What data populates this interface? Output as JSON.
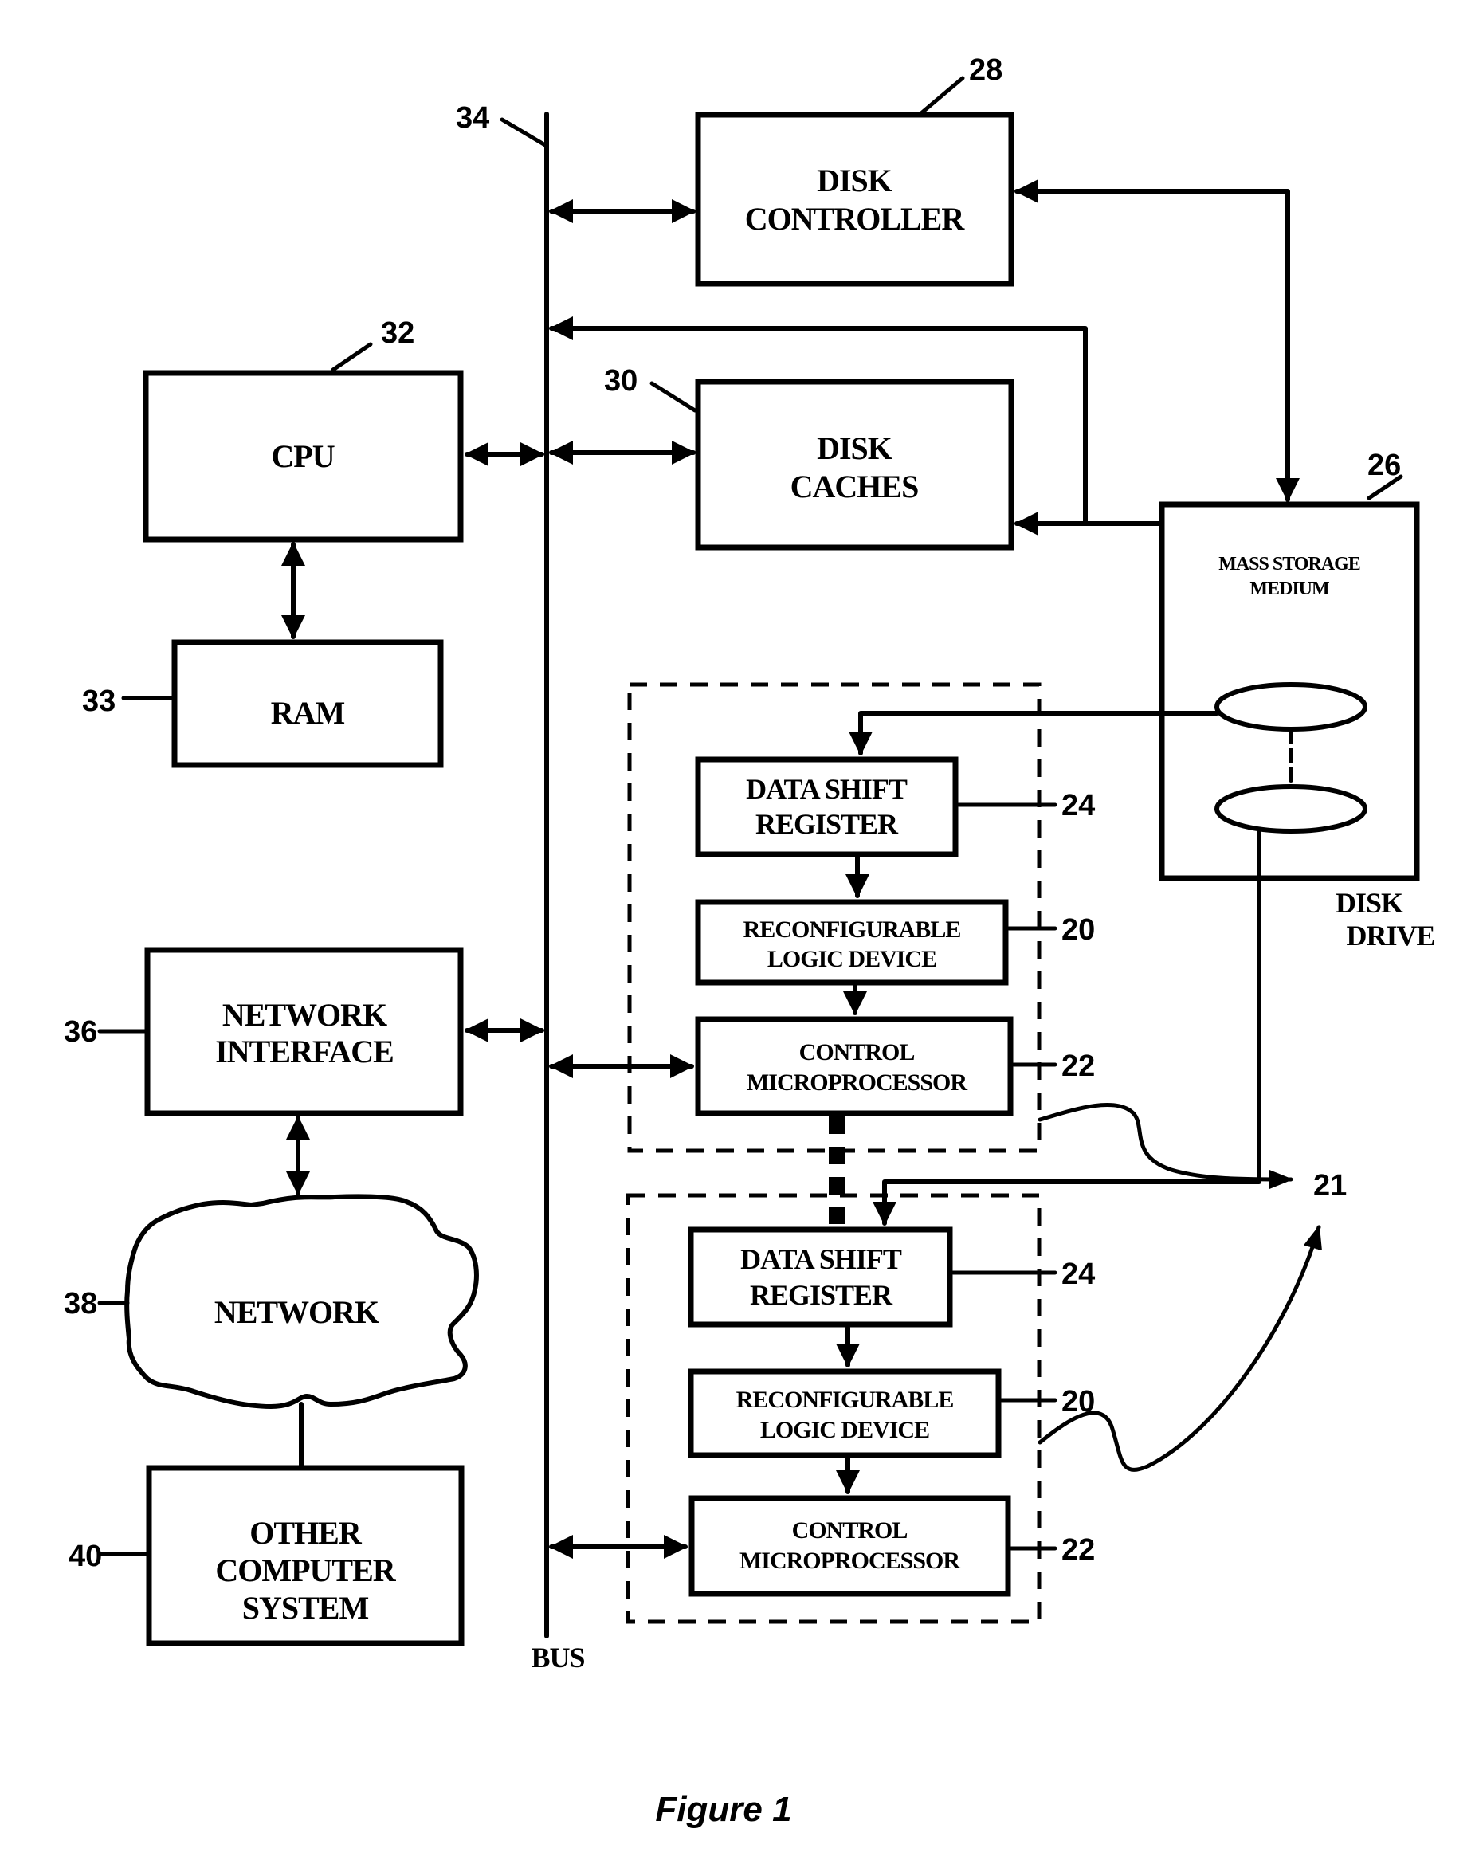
{
  "figure": {
    "caption": "Figure 1",
    "bus_label": "BUS",
    "disk_drive_label": [
      "DISK",
      "DRIVE"
    ]
  },
  "blocks": {
    "disk_controller": {
      "lines": [
        "DISK",
        "CONTROLLER"
      ],
      "ref": "28"
    },
    "disk_caches": {
      "lines": [
        "DISK",
        "CACHES"
      ],
      "ref": "30"
    },
    "cpu": {
      "lines": [
        "CPU"
      ],
      "ref": "32"
    },
    "ram": {
      "lines": [
        "RAM"
      ],
      "ref": "33"
    },
    "bus": {
      "ref": "34"
    },
    "mass_storage": {
      "lines": [
        "MASS STORAGE",
        "MEDIUM"
      ],
      "ref": "26"
    },
    "network_interface": {
      "lines": [
        "NETWORK",
        "INTERFACE"
      ],
      "ref": "36"
    },
    "network": {
      "lines": [
        "NETWORK"
      ],
      "ref": "38"
    },
    "other_computer": {
      "lines": [
        "OTHER",
        "COMPUTER",
        "SYSTEM"
      ],
      "ref": "40"
    }
  },
  "modules": [
    {
      "data_shift_register": {
        "lines": [
          "DATA SHIFT",
          "REGISTER"
        ],
        "ref": "24"
      },
      "reconfigurable_logic": {
        "lines": [
          "RECONFIGURABLE",
          "LOGIC DEVICE"
        ],
        "ref": "20"
      },
      "control_microprocessor": {
        "lines": [
          "CONTROL",
          "MICROPROCESSOR"
        ],
        "ref": "22"
      }
    },
    {
      "data_shift_register": {
        "lines": [
          "DATA SHIFT",
          "REGISTER"
        ],
        "ref": "24"
      },
      "reconfigurable_logic": {
        "lines": [
          "RECONFIGURABLE",
          "LOGIC DEVICE"
        ],
        "ref": "20"
      },
      "control_microprocessor": {
        "lines": [
          "CONTROL",
          "MICROPROCESSOR"
        ],
        "ref": "22"
      }
    }
  ],
  "module_group_ref": "21"
}
